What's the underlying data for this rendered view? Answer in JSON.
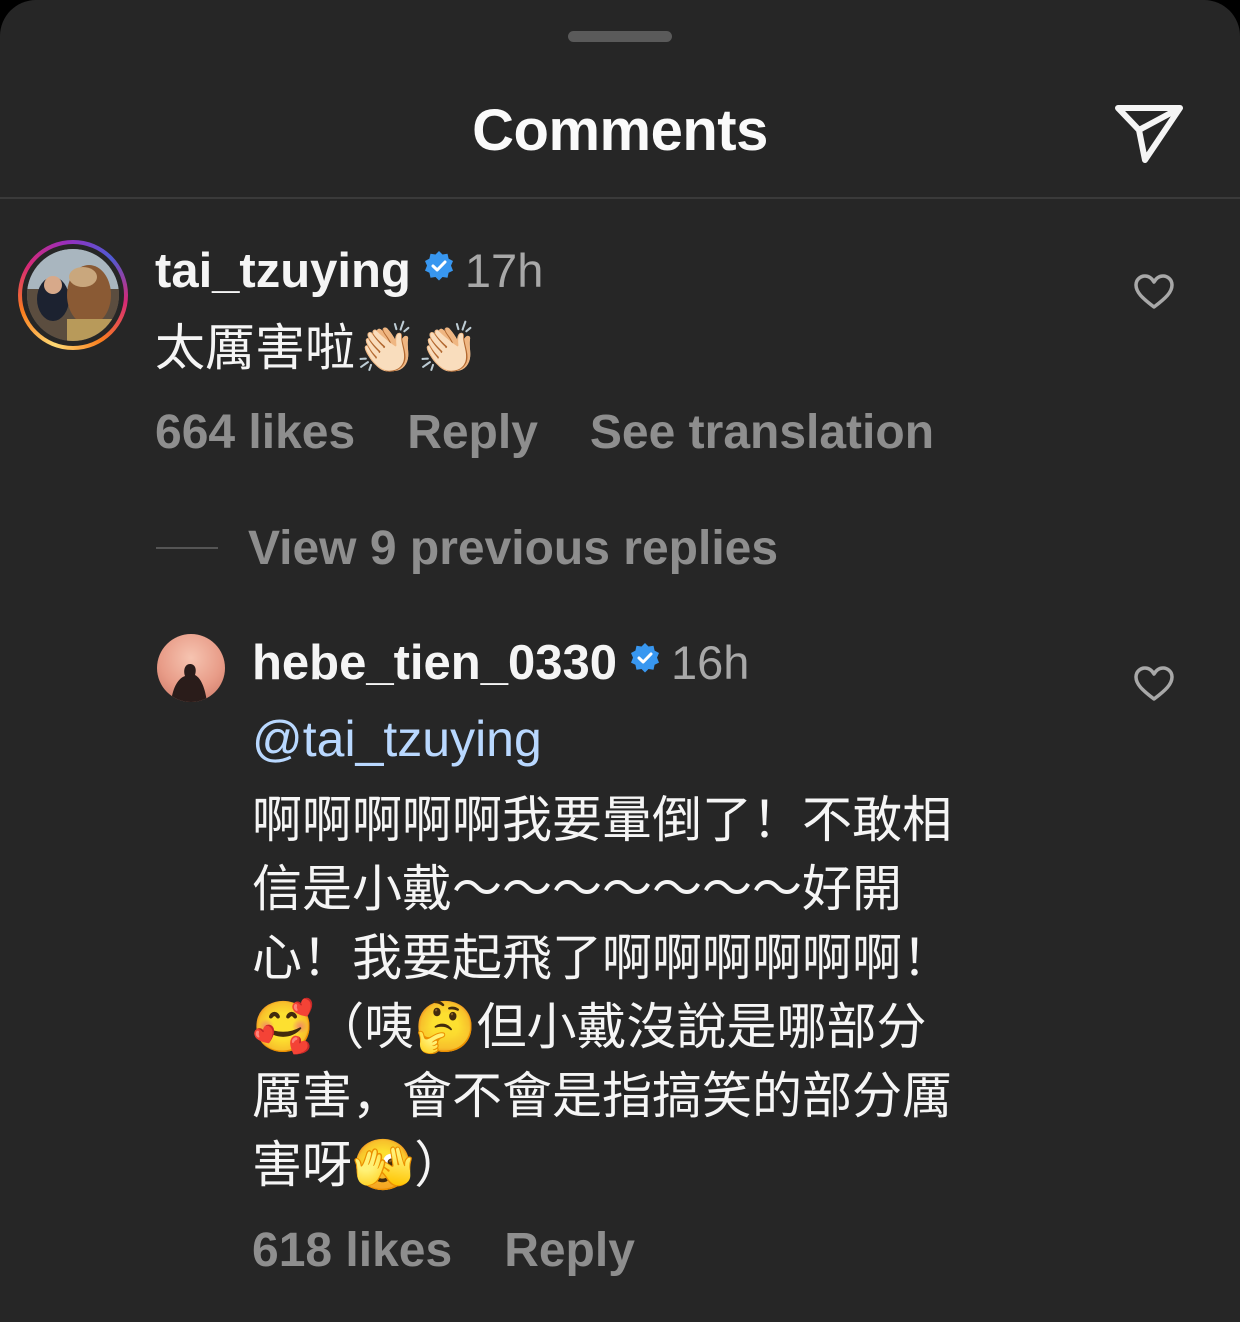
{
  "header": {
    "title": "Comments"
  },
  "comments": [
    {
      "username": "tai_tzuying",
      "verified": true,
      "time": "17h",
      "text": "太厲害啦👏🏻👏🏻",
      "likes": "664 likes",
      "reply_label": "Reply",
      "translate_label": "See translation",
      "view_replies": "View 9 previous replies"
    },
    {
      "username": "hebe_tien_0330",
      "verified": true,
      "time": "16h",
      "mention": "@tai_tzuying",
      "text": "啊啊啊啊啊我要暈倒了！不敢相\n信是小戴～～～～～～～好開\n心！我要起飛了啊啊啊啊啊啊！\n🥰（咦🤔但小戴沒說是哪部分\n厲害，會不會是指搞笑的部分厲\n害呀🫣）",
      "likes": "618 likes",
      "reply_label": "Reply"
    }
  ],
  "colors": {
    "background": "#262626",
    "text": "#f5f5f5",
    "muted": "#8e8e8e",
    "verified": "#3897f0",
    "mention": "#b9d8ff"
  }
}
